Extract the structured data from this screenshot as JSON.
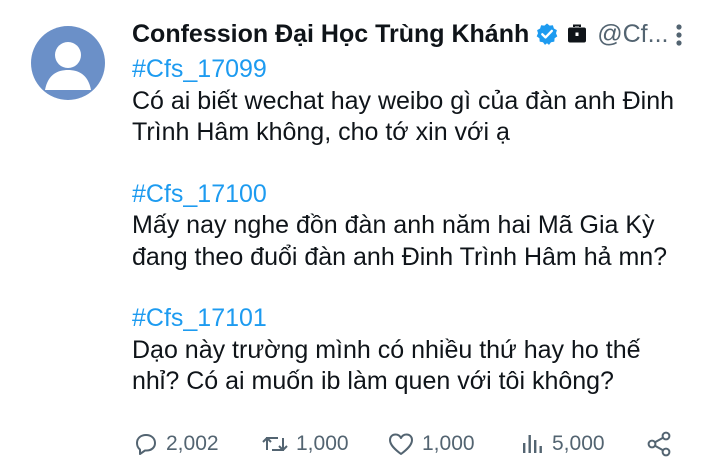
{
  "account": {
    "name": "Confession Đại Học Trùng Khánh",
    "handle": "@Cf...",
    "verified_icon": "verified-badge-icon",
    "bag_icon": "briefcase-icon"
  },
  "posts": [
    {
      "tag": "#Cfs_17099",
      "lines": [
        "Có ai biết wechat hay weibo gì của đàn anh Đinh",
        "Trình Hâm không, cho tớ xin với ạ"
      ]
    },
    {
      "tag": "#Cfs_17100",
      "lines": [
        "Mấy nay nghe đồn đàn anh năm hai Mã Gia Kỳ",
        "đang theo đuổi đàn anh Đinh Trình Hâm hả mn?"
      ]
    },
    {
      "tag": "#Cfs_17101",
      "lines": [
        "Dạo này trường mình có nhiều thứ hay ho thế",
        "nhỉ? Có ai muốn ib làm quen với tôi không?"
      ]
    }
  ],
  "actions": {
    "replies": "2,002",
    "retweets": "1,000",
    "likes": "1,000",
    "views": "5,000"
  },
  "colors": {
    "link": "#1d9bf0",
    "secondary": "#536471",
    "avatar_bg": "#6b90c8"
  }
}
